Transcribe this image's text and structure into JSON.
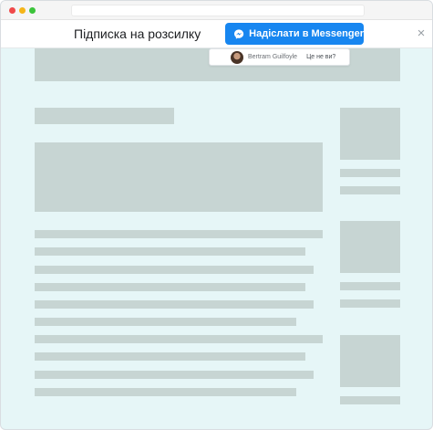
{
  "topbar": {
    "title": "Підписка на розсилку",
    "send_button": {
      "label": "Надіслати в Messenger",
      "icon": "messenger-icon",
      "color": "#1786f0"
    },
    "close_icon": "×"
  },
  "user": {
    "name": "Bertram Guilfoyle",
    "not_you": "Це не ви?"
  },
  "colors": {
    "page_background": "#e6f6f7",
    "placeholder": "#c7d5d3",
    "accent": "#1786f0"
  }
}
